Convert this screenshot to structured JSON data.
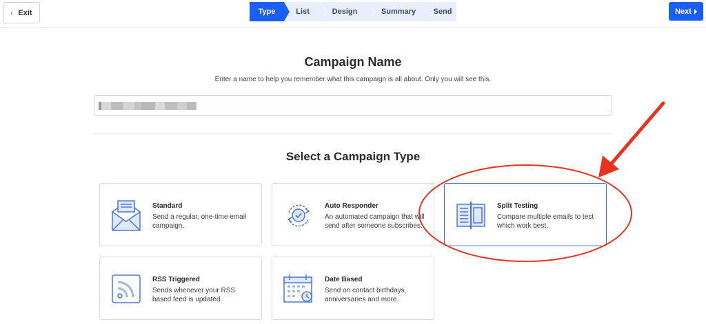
{
  "topbar": {
    "exit_label": "Exit",
    "next_label": "Next",
    "steps": [
      {
        "label": "Type",
        "active": true
      },
      {
        "label": "List",
        "active": false
      },
      {
        "label": "Design",
        "active": false
      },
      {
        "label": "Summary",
        "active": false
      },
      {
        "label": "Send",
        "active": false
      }
    ]
  },
  "campaign_name": {
    "title": "Campaign Name",
    "subtitle": "Enter a name to help you remember what this campaign is all about. Only you will see this.",
    "value": ""
  },
  "campaign_type": {
    "title": "Select a Campaign Type",
    "cards": [
      {
        "title": "Standard",
        "description": "Send a regular, one-time email campaign.",
        "icon": "envelope-icon"
      },
      {
        "title": "Auto Responder",
        "description": "An automated campaign that will send after someone subscribes.",
        "icon": "autoresponder-cycle-icon"
      },
      {
        "title": "Split Testing",
        "description": "Compare multiple emails to test which work best.",
        "icon": "split-document-icon",
        "selected": true
      },
      {
        "title": "RSS Triggered",
        "description": "Sends whenever your RSS based feed is updated.",
        "icon": "rss-icon"
      },
      {
        "title": "Date Based",
        "description": "Send on contact birthdays, anniversaries and more.",
        "icon": "calendar-icon"
      }
    ]
  },
  "colors": {
    "accent": "#1a5ff5",
    "step_inactive": "#e8eefc",
    "annotation": "#e8321e",
    "icon_blue": "#4a78d8"
  }
}
